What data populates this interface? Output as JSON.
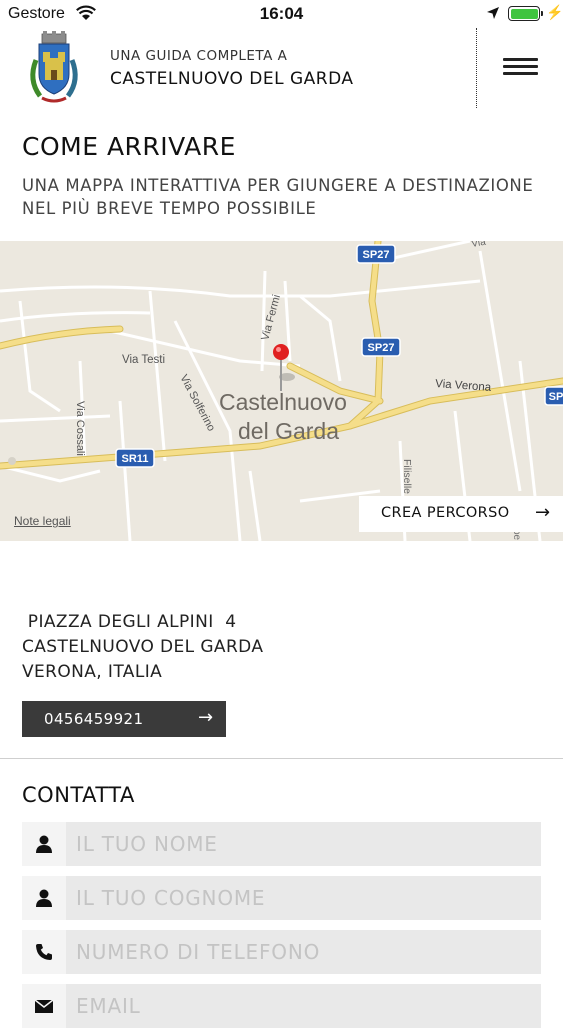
{
  "status_bar": {
    "carrier": "Gestore",
    "time": "16:04"
  },
  "header": {
    "subtitle": "UNA GUIDA COMPLETA A",
    "title": "CASTELNUOVO DEL GARDA"
  },
  "section": {
    "title": "COME ARRIVARE",
    "description": "UNA MAPPA INTERATTIVA PER GIUNGERE A DESTINAZIONE NEL PIÙ BREVE TEMPO POSSIBILE"
  },
  "map": {
    "town_name_line1": "Castelnuovo",
    "town_name_line2": "del Garda",
    "streets": {
      "testi": "Via Testi",
      "fermi": "Via Fermi",
      "solferino": "Via Solferino",
      "cossali": "Via Cossali",
      "verona": "Via Verona",
      "filiselle": "Filiselle",
      "via_partial": "Via",
      "be_partial": "be"
    },
    "road_badges": {
      "sp27_top": "SP27",
      "sp27_mid": "SP27",
      "sr11": "SR11",
      "sp_right": "SP"
    },
    "legal_label": "Note legali",
    "route_button_label": "CREA PERCORSO"
  },
  "address": {
    "line1": " PIAZZA DEGLI ALPINI  4",
    "line2": "CASTELNUOVO DEL GARDA",
    "line3": "VERONA, ITALIA"
  },
  "phone_button": {
    "label": "0456459921"
  },
  "contact": {
    "title": "CONTATTA",
    "fields": [
      {
        "icon": "person-icon",
        "placeholder": "IL TUO NOME"
      },
      {
        "icon": "person-icon",
        "placeholder": "IL TUO COGNOME"
      },
      {
        "icon": "phone-icon",
        "placeholder": "NUMERO DI TELEFONO"
      },
      {
        "icon": "mail-icon",
        "placeholder": "EMAIL"
      }
    ]
  },
  "colors": {
    "map_background": "#ece8df",
    "road_yellow": "#f5de8a",
    "badge_blue": "#2a5db0",
    "pin_red": "#e02020",
    "phone_button_bg": "#3a3a3a",
    "input_bg": "#e9e9e9",
    "battery_green": "#3fc43f"
  }
}
